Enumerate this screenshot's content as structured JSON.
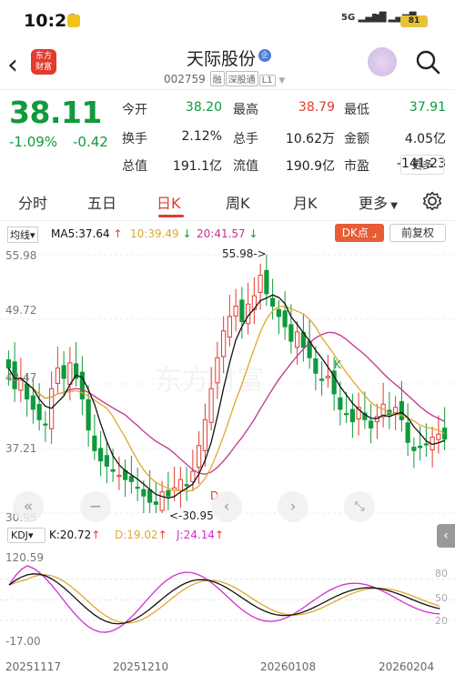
{
  "status_bar": {
    "time": "10:21",
    "signal1": "5G",
    "signal2": "5G",
    "battery": "81"
  },
  "header": {
    "logo_line1": "东方",
    "logo_line2": "财富",
    "name": "天际股份",
    "ent_badge": "企",
    "code": "002759",
    "tags": [
      "融",
      "深股通",
      "L1"
    ]
  },
  "quote": {
    "price": "38.11",
    "change_pct": "-1.09%",
    "change": "-0.42",
    "fields": [
      {
        "label": "今开",
        "value": "38.20",
        "color": "#0f9a3c"
      },
      {
        "label": "最高",
        "value": "38.79",
        "color": "#e23b2e"
      },
      {
        "label": "最低",
        "value": "37.91",
        "color": "#0f9a3c"
      },
      {
        "label": "换手",
        "value": "2.12%",
        "color": "#222222"
      },
      {
        "label": "总手",
        "value": "10.62万",
        "color": "#222222"
      },
      {
        "label": "金额",
        "value": "4.05亿",
        "color": "#222222"
      },
      {
        "label": "总值",
        "value": "191.1亿",
        "color": "#222222"
      },
      {
        "label": "流值",
        "value": "190.9亿",
        "color": "#222222"
      },
      {
        "label": "市盈",
        "value": "-141.23",
        "color": "#222222"
      }
    ],
    "more": "更多"
  },
  "tabs": [
    "分时",
    "五日",
    "日K",
    "周K",
    "月K",
    "更多"
  ],
  "active_tab": "日K",
  "kline_bar": {
    "ma_select": "均线",
    "ma5": "MA5:37.64",
    "ma10": "10:39.49",
    "ma20": "20:41.57",
    "dk": "DK点",
    "fq": "前复权"
  },
  "kline_axis": {
    "y_labels": [
      "55.98",
      "49.72",
      "43.47",
      "37.21",
      "30.95"
    ]
  },
  "annotations": {
    "high": "55.98->",
    "low": "<-30.95",
    "k_mark": "K",
    "d_mark": "D"
  },
  "kdj_bar": {
    "select": "KDJ",
    "k": "K:20.72",
    "d": "D:19.02",
    "j": "J:24.14"
  },
  "kdj_axis": {
    "top": "120.59",
    "bottom": "-17.00",
    "right_labels": [
      "80",
      "50",
      "20"
    ]
  },
  "x_labels": [
    "20251117",
    "20251210",
    "20260108",
    "20260204"
  ],
  "colors": {
    "up": "#e23b2e",
    "down": "#0f9a3c",
    "ma5": "#111111",
    "ma10": "#e0a82e",
    "ma20": "#c2338f",
    "kdj_j": "#d12fd1"
  },
  "icons": [
    "back-icon",
    "search-icon",
    "settings-icon",
    "zoom-out-icon",
    "prev-icon",
    "next-icon",
    "fullscreen-icon"
  ]
}
